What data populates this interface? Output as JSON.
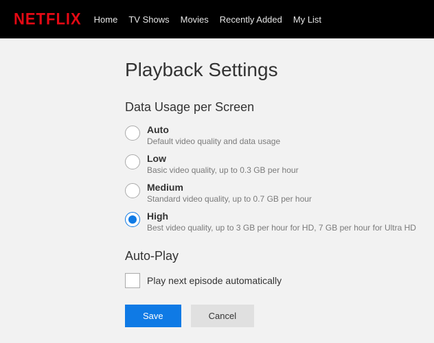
{
  "brand": {
    "logo_text": "NETFLIX"
  },
  "nav": {
    "items": [
      {
        "label": "Home"
      },
      {
        "label": "TV Shows"
      },
      {
        "label": "Movies"
      },
      {
        "label": "Recently Added"
      },
      {
        "label": "My List"
      }
    ]
  },
  "page": {
    "title": "Playback Settings"
  },
  "data_usage": {
    "section_title": "Data Usage per Screen",
    "options": [
      {
        "label": "Auto",
        "description": "Default video quality and data usage",
        "selected": false
      },
      {
        "label": "Low",
        "description": "Basic video quality, up to 0.3 GB per hour",
        "selected": false
      },
      {
        "label": "Medium",
        "description": "Standard video quality, up to 0.7 GB per hour",
        "selected": false
      },
      {
        "label": "High",
        "description": "Best video quality, up to 3 GB per hour for HD, 7 GB per hour for Ultra HD",
        "selected": true
      }
    ]
  },
  "autoplay": {
    "section_title": "Auto-Play",
    "checkbox_label": "Play next episode automatically",
    "checked": false
  },
  "buttons": {
    "save": "Save",
    "cancel": "Cancel"
  }
}
